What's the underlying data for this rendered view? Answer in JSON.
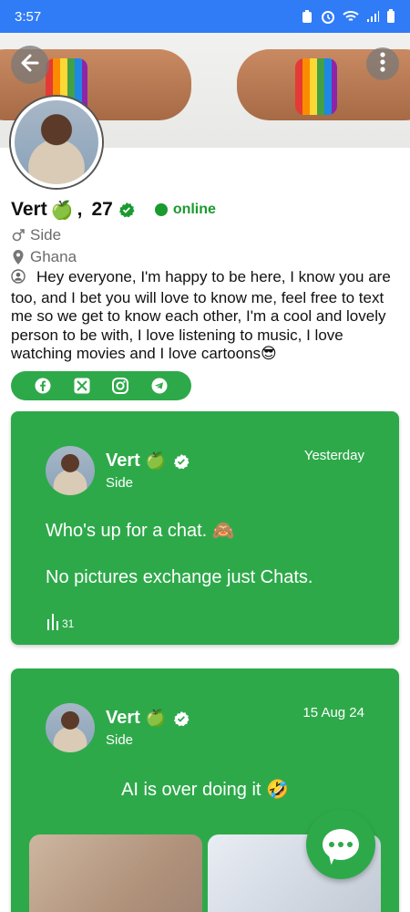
{
  "status": {
    "time": "3:57"
  },
  "profile": {
    "name": "Vert",
    "emoji": "🍏",
    "comma": ",",
    "age": "27",
    "online": "online",
    "gender": "Side",
    "location": "Ghana",
    "bio": "Hey everyone, I'm happy to be here, I know you are too, and I bet you will love to know me, feel free to text me so we get to know each other, I'm a cool and lovely person to be with, I love listening to music, I love watching movies and I love cartoons😎"
  },
  "social_icons": [
    "facebook-icon",
    "x-icon",
    "instagram-icon",
    "telegram-icon"
  ],
  "posts": [
    {
      "name": "Vert",
      "emoji": "🍏",
      "gender": "Side",
      "date": "Yesterday",
      "line1": "Who's up for a chat. 🙈",
      "line2": "No pictures exchange just Chats.",
      "views": "31"
    },
    {
      "name": "Vert",
      "emoji": "🍏",
      "gender": "Side",
      "date": "15 Aug 24",
      "text": "AI is over doing it 🤣"
    }
  ],
  "colors": {
    "accent": "#2ea94a",
    "statusbar": "#2f7cf6",
    "online": "#1a9a2f"
  }
}
